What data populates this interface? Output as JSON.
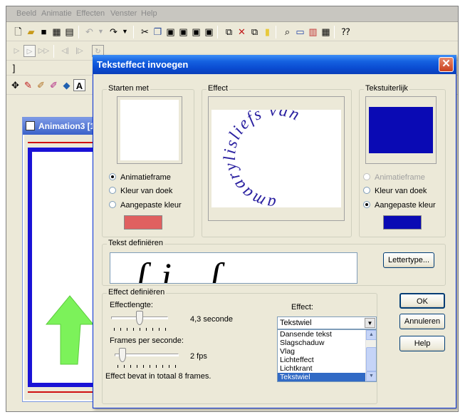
{
  "menu": [
    "Beeld",
    "Animatie",
    "Effecten",
    "Venster",
    "Help"
  ],
  "background_window": {
    "title": "Animation3 [1:"
  },
  "dialog": {
    "title": "Teksteffect invoegen",
    "start": {
      "label": "Starten met",
      "options": [
        "Animatieframe",
        "Kleur van doek",
        "Aangepaste kleur"
      ],
      "selected_index": 0,
      "custom_color": "#e06060"
    },
    "effect_preview": {
      "label": "Effect",
      "circle_text": "amaarylisliefs van",
      "color": "#2a20a0"
    },
    "text_look": {
      "label": "Tekstuiterlijk",
      "options": [
        "Animatieframe",
        "Kleur van doek",
        "Aangepaste kleur"
      ],
      "disabled_index": 0,
      "selected_index": 2,
      "preview_color": "#0a0ab4",
      "custom_color": "#0a0ab4"
    },
    "define_text": {
      "label": "Tekst definiëren",
      "font_button": "Lettertype...",
      "preview_glyphs": "ſi ſ"
    },
    "define_effect": {
      "label": "Effect definiëren",
      "length_label": "Effectlengte:",
      "length_value": "4,3 seconde",
      "length_fraction": 0.5,
      "fps_label": "Frames per seconde:",
      "fps_value": "2 fps",
      "fps_fraction": 0.07,
      "summary": "Effect bevat in totaal 8 frames.",
      "effect_label": "Effect:",
      "selected_effect": "Tekstwiel",
      "effect_options": [
        "Dansende tekst",
        "Slagschaduw",
        "Vlag",
        "Lichteffect",
        "Lichtkrant",
        "Tekstwiel"
      ],
      "selected_effect_index": 5
    },
    "buttons": {
      "ok": "OK",
      "cancel": "Annuleren",
      "help": "Help"
    }
  }
}
